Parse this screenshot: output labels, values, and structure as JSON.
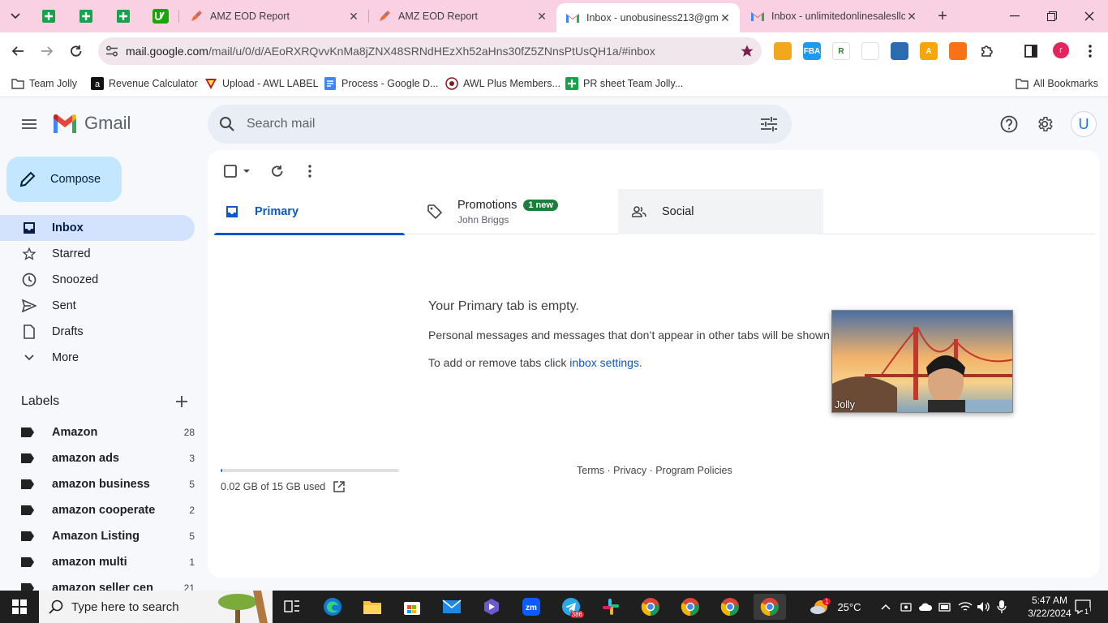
{
  "chrome": {
    "tabs": [
      {
        "title": "AMZ EOD Report",
        "active": false
      },
      {
        "title": "AMZ EOD Report",
        "active": false
      },
      {
        "title": "Inbox - unobusiness213@gma",
        "active": true
      },
      {
        "title": "Inbox - unlimitedonlinesalesllc",
        "active": false
      }
    ],
    "close_glyph": "✕",
    "new_tab_glyph": "+",
    "url_host": "mail.google.com",
    "url_path": "/mail/u/0/d/AEoRXRQvvKnMa8jZNX48SRNdHEzXh52aHns30fZ5ZNnsPtUsQH1a/#inbox",
    "profile_initial": "r",
    "extensions": [
      {
        "icon": "honey-icon",
        "color": "#f1a81d",
        "text": ""
      },
      {
        "icon": "fba-icon",
        "color": "#1d9bf0",
        "text": "FBA"
      },
      {
        "icon": "keepa-icon",
        "color": "#ffffff",
        "text": "R"
      },
      {
        "icon": "helium-icon",
        "color": "#ffffff",
        "text": ""
      },
      {
        "icon": "aura-icon",
        "color": "#2b6cb0",
        "text": ""
      },
      {
        "icon": "scout-icon",
        "color": "#f6a609",
        "text": "A"
      },
      {
        "icon": "firefox-style-icon",
        "color": "#f97316",
        "text": ""
      }
    ]
  },
  "bookmarks": [
    {
      "label": "Team Jolly",
      "icon": "folder-icon"
    },
    {
      "label": "Revenue Calculator",
      "icon": "amazon-icon"
    },
    {
      "label": "Upload - AWL LABEL",
      "icon": "awl-icon"
    },
    {
      "label": "Process - Google D...",
      "icon": "docs-icon"
    },
    {
      "label": "AWL Plus Members...",
      "icon": "awl-plus-icon"
    },
    {
      "label": "PR sheet Team Jolly...",
      "icon": "sheets-icon"
    }
  ],
  "all_bookmarks": "All Bookmarks",
  "gmail": {
    "logo_text": "Gmail",
    "search_placeholder": "Search mail",
    "account_initial": "U",
    "compose_label": "Compose",
    "nav": [
      {
        "label": "Inbox",
        "icon": "inbox-icon",
        "active": true
      },
      {
        "label": "Starred",
        "icon": "star-icon",
        "active": false
      },
      {
        "label": "Snoozed",
        "icon": "clock-icon",
        "active": false
      },
      {
        "label": "Sent",
        "icon": "send-icon",
        "active": false
      },
      {
        "label": "Drafts",
        "icon": "draft-icon",
        "active": false
      },
      {
        "label": "More",
        "icon": "chevron-down-icon",
        "active": false
      }
    ],
    "labels_heading": "Labels",
    "labels": [
      {
        "name": "Amazon",
        "count": "28"
      },
      {
        "name": "amazon ads",
        "count": "3"
      },
      {
        "name": "amazon business",
        "count": "5"
      },
      {
        "name": "amazon cooperate",
        "count": "2"
      },
      {
        "name": "Amazon Listing",
        "count": "5"
      },
      {
        "name": "amazon multi",
        "count": "1"
      },
      {
        "name": "amazon seller cen",
        "count": "21"
      }
    ],
    "tabs": {
      "primary": "Primary",
      "promotions": "Promotions",
      "promotions_badge": "1 new",
      "promotions_sender": "John Briggs",
      "social": "Social"
    },
    "empty": {
      "title": "Your Primary tab is empty.",
      "line1": "Personal messages and messages that don’t appear in other tabs will be shown here.",
      "line2_prefix": "To add or remove tabs click ",
      "line2_link": "inbox settings",
      "line2_suffix": "."
    },
    "storage": {
      "text": "0.02 GB of 15 GB used",
      "used_fraction": 0.0013
    },
    "footer": "Terms · Privacy · Program Policies"
  },
  "video_overlay": {
    "name": "Jolly"
  },
  "taskbar": {
    "search_placeholder": "Type here to search",
    "telegram_badge": "386",
    "weather": "25°C",
    "weather_alert": "1",
    "time": "5:47 AM",
    "date": "3/22/2024",
    "notifications": "1"
  }
}
